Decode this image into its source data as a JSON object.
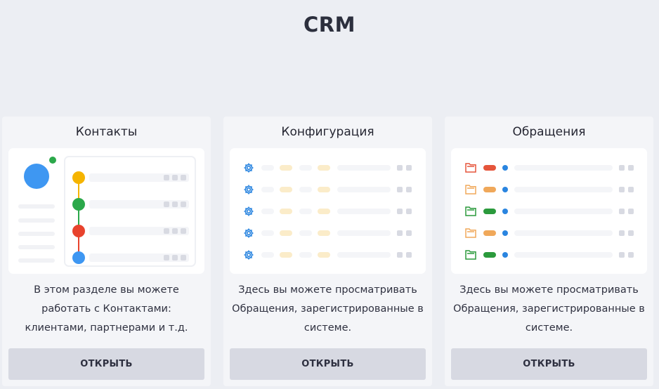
{
  "app": {
    "logo_text": "CRM",
    "accent_color": "#f2a51b"
  },
  "cards": [
    {
      "title": "Контакты",
      "description": "В этом разделе вы можете работать с Контактами: клиентами, партнерами и т.д.",
      "button_label": "ОТКРЫТЬ",
      "preview_icon": "contacts-timeline"
    },
    {
      "title": "Конфигурация",
      "description": "Здесь вы можете просматривать Обращения, зарегистрированные в системе.",
      "button_label": "ОТКРЫТЬ",
      "preview_icon": "gear-icon"
    },
    {
      "title": "Обращения",
      "description": "Здесь вы можете просматривать Обращения, зарегистрированные в системе.",
      "button_label": "ОТКРЫТЬ",
      "preview_icon": "folder-icon"
    }
  ],
  "colors": {
    "node_yellow": "#f5b400",
    "node_green": "#2ba84a",
    "node_red": "#e8432d",
    "node_blue": "#3e97f2",
    "folder_red": "#e5553b",
    "folder_orange": "#f0a85a",
    "folder_green": "#2b9a3c"
  }
}
